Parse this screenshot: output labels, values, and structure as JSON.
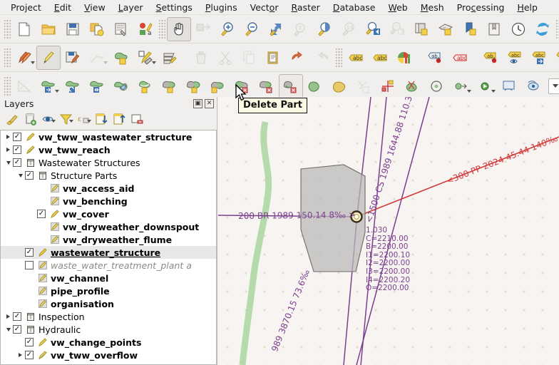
{
  "menubar": {
    "items": [
      {
        "label": "Project",
        "mnemonic": "j"
      },
      {
        "label": "Edit",
        "mnemonic": "E"
      },
      {
        "label": "View",
        "mnemonic": "V"
      },
      {
        "label": "Layer",
        "mnemonic": "L"
      },
      {
        "label": "Settings",
        "mnemonic": "S"
      },
      {
        "label": "Plugins",
        "mnemonic": "P"
      },
      {
        "label": "Vector",
        "mnemonic": "o"
      },
      {
        "label": "Raster",
        "mnemonic": "R"
      },
      {
        "label": "Database",
        "mnemonic": "D"
      },
      {
        "label": "Web",
        "mnemonic": "W"
      },
      {
        "label": "Mesh",
        "mnemonic": "M"
      },
      {
        "label": "Processing",
        "mnemonic": "c"
      },
      {
        "label": "Help",
        "mnemonic": "H"
      }
    ]
  },
  "toolbar_project": {
    "buttons": [
      {
        "name": "new-project-button",
        "icon": "new-document-icon",
        "state": "enabled"
      },
      {
        "name": "open-project-button",
        "icon": "open-folder-icon",
        "state": "enabled"
      },
      {
        "name": "save-project-button",
        "icon": "save-floppy-icon",
        "state": "enabled"
      },
      {
        "name": "save-project-as-button",
        "icon": "save-as-icon",
        "state": "enabled"
      },
      {
        "name": "new-print-layout-button",
        "icon": "layout-designer-icon",
        "state": "enabled"
      },
      {
        "name": "style-manager-button",
        "icon": "style-manager-icon",
        "state": "enabled"
      },
      {
        "name": "pan-map-button",
        "icon": "pan-hand-icon",
        "state": "active"
      },
      {
        "name": "pan-to-selection-button",
        "icon": "pan-to-selection-icon",
        "state": "disabled"
      },
      {
        "name": "zoom-in-button",
        "icon": "zoom-in-icon",
        "state": "enabled"
      },
      {
        "name": "zoom-out-button",
        "icon": "zoom-out-icon",
        "state": "enabled"
      },
      {
        "name": "zoom-full-button",
        "icon": "zoom-full-icon",
        "state": "enabled"
      },
      {
        "name": "zoom-to-selection-button",
        "icon": "zoom-to-selection-icon",
        "state": "disabled"
      },
      {
        "name": "zoom-to-layer-button",
        "icon": "zoom-to-layer-icon",
        "state": "enabled"
      },
      {
        "name": "zoom-native-button",
        "icon": "zoom-native-1-1-icon",
        "state": "disabled"
      },
      {
        "name": "zoom-last-button",
        "icon": "zoom-last-icon",
        "state": "enabled"
      },
      {
        "name": "zoom-next-button",
        "icon": "zoom-next-icon",
        "state": "disabled"
      },
      {
        "name": "new-map-view-button",
        "icon": "new-map-view-icon",
        "state": "enabled"
      },
      {
        "name": "new-3d-map-view-button",
        "icon": "new-3d-view-icon",
        "state": "enabled"
      },
      {
        "name": "new-bookmark-button",
        "icon": "new-bookmark-icon",
        "state": "enabled"
      },
      {
        "name": "show-bookmarks-button",
        "icon": "show-bookmarks-icon",
        "state": "enabled"
      },
      {
        "name": "temporal-controller-button",
        "icon": "clock-icon",
        "state": "enabled"
      },
      {
        "name": "refresh-map-button",
        "icon": "refresh-icon",
        "state": "enabled"
      },
      {
        "name": "select-features-button",
        "icon": "select-features-icon",
        "state": "enabled"
      }
    ]
  },
  "toolbar_digitizing": {
    "buttons": [
      {
        "name": "current-edits-button",
        "icon": "current-edits-pencils-icon",
        "state": "enabled"
      },
      {
        "name": "toggle-editing-button",
        "icon": "toggle-editing-pencil-icon",
        "state": "active"
      },
      {
        "name": "save-layer-edits-button",
        "icon": "save-layer-edits-icon",
        "state": "enabled"
      },
      {
        "name": "add-line-feature-button",
        "icon": "add-line-feature-icon",
        "state": "disabled"
      },
      {
        "name": "add-polygon-feature-button",
        "icon": "add-polygon-feature-icon",
        "state": "enabled"
      },
      {
        "name": "vertex-tool-button",
        "icon": "vertex-tool-icon",
        "state": "enabled"
      },
      {
        "name": "modify-attributes-button",
        "icon": "modify-attributes-icon",
        "state": "enabled"
      },
      {
        "name": "delete-selected-button",
        "icon": "trash-icon",
        "state": "disabled"
      },
      {
        "name": "cut-features-button",
        "icon": "scissors-icon",
        "state": "disabled"
      },
      {
        "name": "copy-features-button",
        "icon": "copy-icon",
        "state": "disabled"
      },
      {
        "name": "paste-features-button",
        "icon": "paste-clipboard-icon",
        "state": "enabled"
      },
      {
        "name": "undo-button",
        "icon": "undo-arrow-icon",
        "state": "enabled"
      },
      {
        "name": "redo-button",
        "icon": "redo-arrow-icon",
        "state": "disabled"
      },
      {
        "name": "label-toolbar-button",
        "icon": "abc-label-icon",
        "state": "enabled"
      },
      {
        "name": "pin-labels-button",
        "icon": "abc-pin-icon",
        "state": "enabled"
      },
      {
        "name": "layer-diagram-button",
        "icon": "diagram-icon",
        "state": "enabled"
      },
      {
        "name": "highlight-pinned-labels-button",
        "icon": "abc-blue-pin-icon",
        "state": "enabled"
      },
      {
        "name": "highlight-labels-button",
        "icon": "abc-red-icon",
        "state": "enabled"
      },
      {
        "name": "move-label-button",
        "icon": "abc-move-pin-icon",
        "state": "enabled"
      },
      {
        "name": "show-hide-labels-button",
        "icon": "abc-eye-icon",
        "state": "enabled"
      },
      {
        "name": "change-label-button",
        "icon": "abc-arrow-icon",
        "state": "enabled"
      },
      {
        "name": "rotate-label-button",
        "icon": "abc-rotate-icon",
        "state": "enabled"
      },
      {
        "name": "label-properties-button",
        "icon": "abc-properties-icon",
        "state": "enabled"
      }
    ]
  },
  "toolbar_advanced_digitizing": {
    "buttons": [
      {
        "name": "enable-advanced-digitizing-button",
        "icon": "set-angle-icon",
        "state": "disabled"
      },
      {
        "name": "move-feature-button",
        "icon": "move-feature-icon",
        "state": "enabled"
      },
      {
        "name": "rotate-feature-button",
        "icon": "rotate-feature-icon",
        "state": "enabled"
      },
      {
        "name": "scale-feature-button",
        "icon": "scale-feature-icon",
        "state": "enabled"
      },
      {
        "name": "offset-curve-button",
        "icon": "offset-curve-icon",
        "state": "enabled"
      },
      {
        "name": "reshape-features-button",
        "icon": "reshape-features-icon",
        "state": "enabled"
      },
      {
        "name": "split-features-button",
        "icon": "split-features-icon",
        "state": "enabled"
      },
      {
        "name": "split-parts-button",
        "icon": "split-parts-icon",
        "state": "enabled"
      },
      {
        "name": "merge-selected-features-button",
        "icon": "merge-features-icon",
        "state": "enabled"
      },
      {
        "name": "merge-attributes-button",
        "icon": "merge-attributes-icon",
        "state": "enabled"
      },
      {
        "name": "add-part-button",
        "icon": "add-part-icon",
        "state": "enabled"
      },
      {
        "name": "delete-part-button",
        "icon": "delete-part-icon",
        "state": "hover"
      },
      {
        "name": "add-ring-button",
        "icon": "add-ring-icon",
        "state": "enabled"
      },
      {
        "name": "fill-ring-button",
        "icon": "fill-ring-icon",
        "state": "enabled"
      },
      {
        "name": "delete-ring-button",
        "icon": "delete-ring-icon",
        "state": "disabled"
      },
      {
        "name": "simplify-feature-button",
        "icon": "simplify-feature-icon",
        "state": "enabled"
      },
      {
        "name": "trim-extend-button",
        "icon": "trim-extend-icon",
        "state": "enabled"
      },
      {
        "name": "rotate-point-symbols-button",
        "icon": "rotate-point-symbols-icon",
        "state": "enabled"
      },
      {
        "name": "offset-point-symbol-button",
        "icon": "offset-point-symbol-icon",
        "state": "enabled"
      },
      {
        "name": "processing-toolbox-button",
        "icon": "processing-gear-icon",
        "state": "enabled"
      },
      {
        "name": "show-map-tips-button",
        "icon": "map-tips-eye-icon",
        "state": "enabled"
      },
      {
        "name": "show-attribute-table-button",
        "icon": "attribute-table-icon",
        "state": "enabled"
      }
    ],
    "combo_value": ""
  },
  "tooltip": {
    "text": "Delete Part"
  },
  "layers_panel": {
    "title": "Layers",
    "float_button": "undock-panel-icon",
    "close_button": "close-panel-icon",
    "toolbar": [
      {
        "name": "open-layer-styling-panel-button",
        "icon": "styling-brush-icon"
      },
      {
        "name": "add-group-button",
        "icon": "add-group-icon"
      },
      {
        "name": "manage-map-themes-button",
        "icon": "map-themes-eye-icon"
      },
      {
        "name": "filter-legend-button",
        "icon": "filter-funnel-icon"
      },
      {
        "name": "filter-legend-expression-button",
        "icon": "expression-filter-icon"
      },
      {
        "name": "expand-all-button",
        "icon": "expand-all-icon"
      },
      {
        "name": "collapse-all-button",
        "icon": "collapse-all-icon"
      },
      {
        "name": "remove-layer-button",
        "icon": "remove-layer-icon"
      }
    ],
    "items": [
      {
        "label": "vw_tww_wastewater_structure",
        "indent": 0,
        "expander": "right",
        "checkbox": "checked",
        "icon": "edit-pencil-icon",
        "style": "bold"
      },
      {
        "label": "vw_tww_reach",
        "indent": 0,
        "expander": "right",
        "checkbox": "checked",
        "icon": "edit-pencil-line-icon",
        "style": "bold"
      },
      {
        "label": "Wastewater Structures",
        "indent": 0,
        "expander": "down",
        "checkbox": "checked",
        "icon": "group-icon",
        "style": "normal"
      },
      {
        "label": "Structure Parts",
        "indent": 1,
        "expander": "down",
        "checkbox": "checked",
        "icon": "group-icon",
        "style": "normal"
      },
      {
        "label": "vw_access_aid",
        "indent": 2,
        "expander": "none",
        "checkbox": "none",
        "icon": "edit-pencil-grey-icon",
        "style": "bold"
      },
      {
        "label": "vw_benching",
        "indent": 2,
        "expander": "none",
        "checkbox": "none",
        "icon": "edit-pencil-grey-icon",
        "style": "bold"
      },
      {
        "label": "vw_cover",
        "indent": 2,
        "expander": "none",
        "checkbox": "checked",
        "icon": "edit-pencil-icon",
        "style": "bold"
      },
      {
        "label": "vw_dryweather_downspout",
        "indent": 2,
        "expander": "none",
        "checkbox": "none",
        "icon": "edit-pencil-grey-icon",
        "style": "bold"
      },
      {
        "label": "vw_dryweather_flume",
        "indent": 2,
        "expander": "none",
        "checkbox": "none",
        "icon": "edit-pencil-grey-icon",
        "style": "bold"
      },
      {
        "label": "wastewater_structure",
        "indent": 1,
        "expander": "none",
        "checkbox": "checked",
        "icon": "edit-pencil-icon",
        "style": "active",
        "selected": true
      },
      {
        "label": "waste_water_treatment_plant a",
        "indent": 1,
        "expander": "none",
        "checkbox": "unchecked",
        "icon": "edit-pencil-grey-icon",
        "style": "dim"
      },
      {
        "label": "vw_channel",
        "indent": 1,
        "expander": "none",
        "checkbox": "none",
        "icon": "edit-pencil-grey-icon",
        "style": "bold"
      },
      {
        "label": "pipe_profile",
        "indent": 1,
        "expander": "none",
        "checkbox": "none",
        "icon": "edit-pencil-grey-icon",
        "style": "bold"
      },
      {
        "label": "organisation",
        "indent": 1,
        "expander": "none",
        "checkbox": "none",
        "icon": "edit-pencil-grey-icon",
        "style": "bold"
      },
      {
        "label": "Inspection",
        "indent": 0,
        "expander": "right",
        "checkbox": "checked",
        "icon": "group-icon",
        "style": "normal"
      },
      {
        "label": "Hydraulic",
        "indent": 0,
        "expander": "down",
        "checkbox": "checked",
        "icon": "group-icon",
        "style": "normal"
      },
      {
        "label": "vw_change_points",
        "indent": 1,
        "expander": "none",
        "checkbox": "checked",
        "icon": "edit-pencil-icon",
        "style": "bold"
      },
      {
        "label": "vw_tww_overflow",
        "indent": 1,
        "expander": "right",
        "checkbox": "checked",
        "icon": "edit-pencil-line-icon",
        "style": "bold"
      }
    ]
  },
  "map": {
    "labels": [
      {
        "name": "reach-label-cs-1989",
        "text": "<1500 CS 1989 1644.88 110.3‰",
        "color": "#7b3f8f"
      },
      {
        "name": "reach-label-br-1989",
        "text": "200 BR 1989 150.14 8‰  >",
        "color": "#7b3f8f"
      },
      {
        "name": "reach-label-pp-2024",
        "text": "<300 PP 2024 45.44 140‰",
        "color": "#d23b3b"
      },
      {
        "name": "reach-label-3870",
        "text": "989 3870.15 73.6‰",
        "color": "#7b3f8f"
      }
    ],
    "structure_attributes": {
      "name": "wastewater-structure-attribute-label",
      "lines": [
        "1.030",
        "C=2210.00",
        "B=2200.00",
        "I1=2200.10",
        "I2=2200.00",
        "I3=2200.00",
        "I4=2200.20",
        "O=2200.00"
      ],
      "color": "#7b3f8f"
    },
    "colors": {
      "canvas_background": "#f7f4f1",
      "reach_purple": "#7b3f8f",
      "reach_red": "#d23b3b",
      "structure_fill": "#b9b9b9",
      "vegetation_green": "#a9d6a0"
    }
  }
}
